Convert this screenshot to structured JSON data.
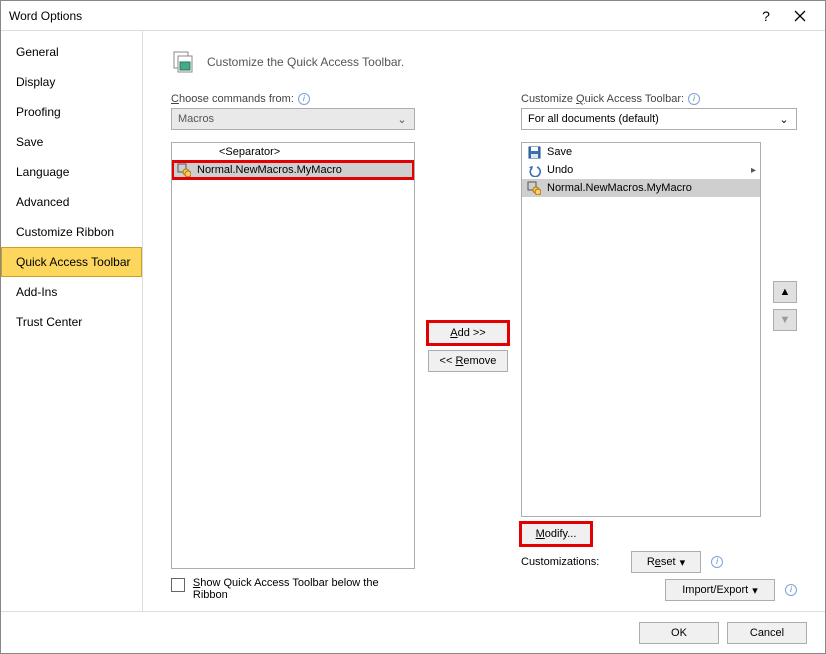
{
  "titlebar": {
    "title": "Word Options"
  },
  "sidebar": {
    "items": [
      {
        "label": "General"
      },
      {
        "label": "Display"
      },
      {
        "label": "Proofing"
      },
      {
        "label": "Save"
      },
      {
        "label": "Language"
      },
      {
        "label": "Advanced"
      },
      {
        "label": "Customize Ribbon"
      },
      {
        "label": "Quick Access Toolbar"
      },
      {
        "label": "Add-Ins"
      },
      {
        "label": "Trust Center"
      }
    ],
    "selected_index": 7
  },
  "heading": "Customize the Quick Access Toolbar.",
  "left": {
    "label_prefix": "C",
    "label_rest": "hoose commands from:",
    "combo_value": "Macros",
    "items": [
      {
        "label": "<Separator>",
        "icon": "none"
      },
      {
        "label": "Normal.NewMacros.MyMacro",
        "icon": "macro",
        "selected": true,
        "highlight": true
      }
    ]
  },
  "mid": {
    "add_label": "Add >>",
    "remove_label": "<< Remove"
  },
  "right": {
    "label_prefix": "Customize ",
    "label_u": "Q",
    "label_rest": "uick Access Toolbar:",
    "combo_value": "For all documents (default)",
    "items": [
      {
        "label": "Save",
        "icon": "save"
      },
      {
        "label": "Undo",
        "icon": "undo",
        "expand": true
      },
      {
        "label": "Normal.NewMacros.MyMacro",
        "icon": "macro",
        "selected": true
      }
    ],
    "modify_label": "Modify...",
    "customizations_label": "Customizations:",
    "reset_label": "Reset",
    "import_export_label": "Import/Export"
  },
  "below_checkbox": {
    "prefix": "S",
    "rest": "how Quick Access Toolbar below the Ribbon"
  },
  "footer": {
    "ok": "OK",
    "cancel": "Cancel"
  }
}
